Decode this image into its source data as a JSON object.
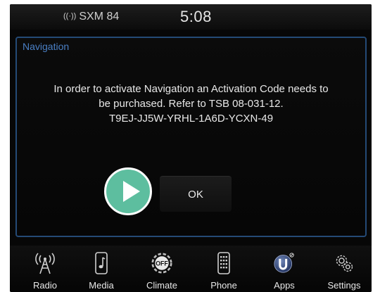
{
  "status_bar": {
    "radio_station": "SXM 84",
    "time": "5:08"
  },
  "dialog": {
    "title": "Navigation",
    "message_lines": [
      "In order to activate Navigation an Activation Code needs to",
      "be purchased. Refer to TSB 08-031-12.",
      "T9EJ-JJ5W-YRHL-1A6D-YCXN-49"
    ],
    "ok_label": "OK"
  },
  "bottom_nav": [
    {
      "label": "Radio",
      "icon": "radio-tower-icon"
    },
    {
      "label": "Media",
      "icon": "media-music-icon"
    },
    {
      "label": "Climate",
      "icon": "climate-off-icon"
    },
    {
      "label": "Phone",
      "icon": "phone-keypad-icon"
    },
    {
      "label": "Apps",
      "icon": "apps-uconnect-icon"
    },
    {
      "label": "Settings",
      "icon": "settings-gears-icon"
    }
  ],
  "colors": {
    "accent_blue": "#4a7fc4",
    "dialog_border": "#244a76",
    "play_button": "#5dbe9f"
  }
}
